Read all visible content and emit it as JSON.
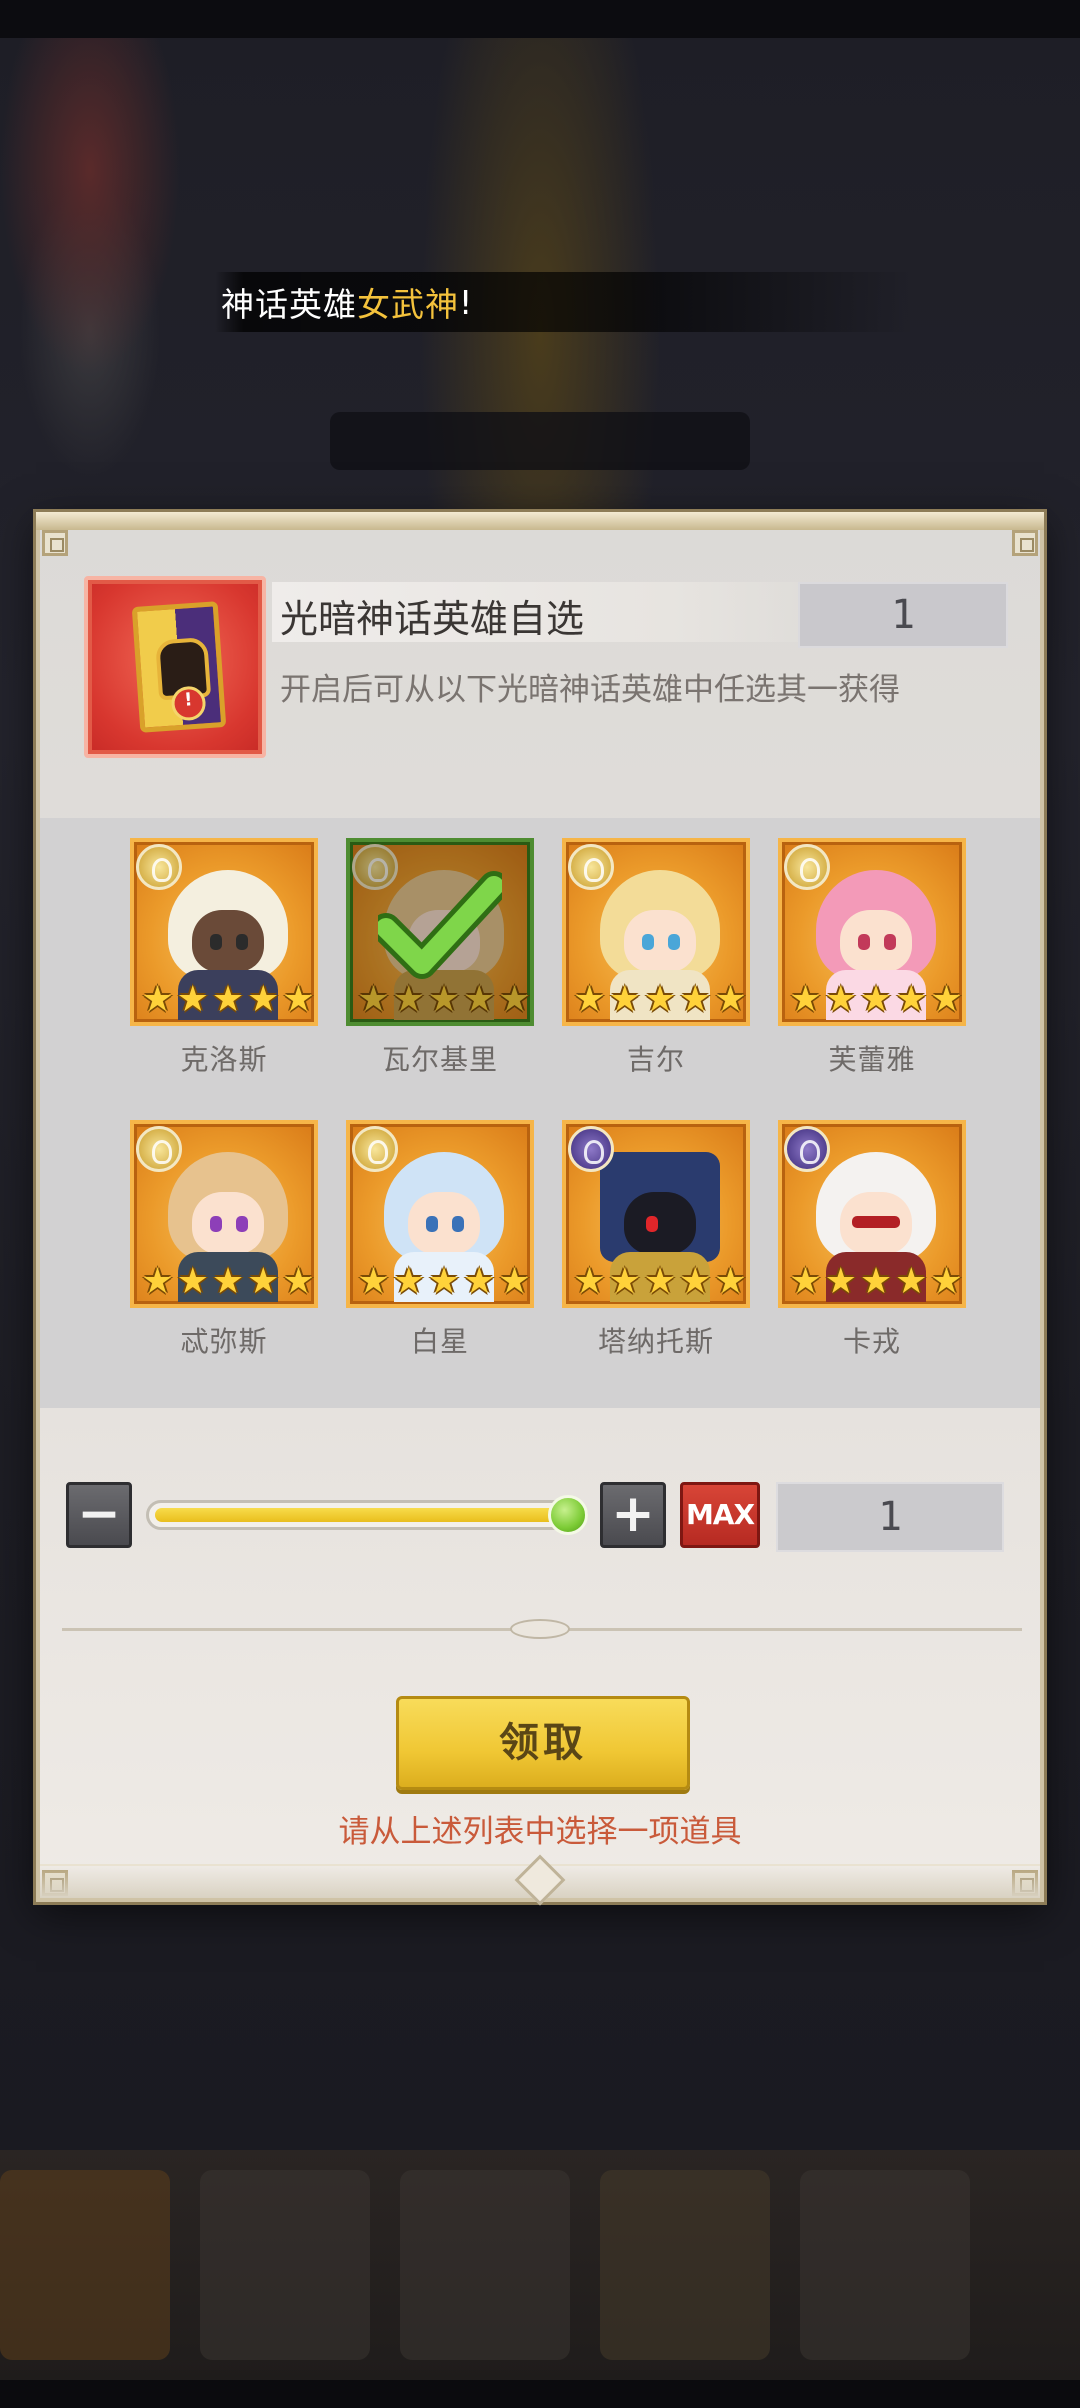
{
  "toast": {
    "prefix": "神话英雄",
    "highlight": "女武神",
    "suffix": "!"
  },
  "dialog": {
    "item_title": "光暗神话英雄自选",
    "item_quantity": "1",
    "item_description": "开启后可从以下光暗神话英雄中任选其一获得",
    "heroes": [
      {
        "name": "克洛斯",
        "element": "light",
        "stars": 5,
        "selected": false
      },
      {
        "name": "瓦尔基里",
        "element": "light",
        "stars": 5,
        "selected": true
      },
      {
        "name": "吉尔",
        "element": "light",
        "stars": 5,
        "selected": false
      },
      {
        "name": "芙蕾雅",
        "element": "light",
        "stars": 5,
        "selected": false
      },
      {
        "name": "忒弥斯",
        "element": "light",
        "stars": 5,
        "selected": false
      },
      {
        "name": "白星",
        "element": "light",
        "stars": 5,
        "selected": false
      },
      {
        "name": "塔纳托斯",
        "element": "dark",
        "stars": 5,
        "selected": false
      },
      {
        "name": "卡戎",
        "element": "dark",
        "stars": 5,
        "selected": false
      }
    ],
    "slider": {
      "fill_fraction": 1.0,
      "minus_icon": "minus-icon",
      "plus_icon": "plus-icon",
      "max_label": "MAX",
      "count_value": "1"
    },
    "claim_label": "领取",
    "hint_text": "请从上述列表中选择一项道具"
  },
  "colors": {
    "accent_gold": "#f4c23c",
    "selected_border": "#6dc244",
    "hint": "#c95a3a",
    "claim_button": "#f0c734",
    "max_button": "#c8362b"
  }
}
